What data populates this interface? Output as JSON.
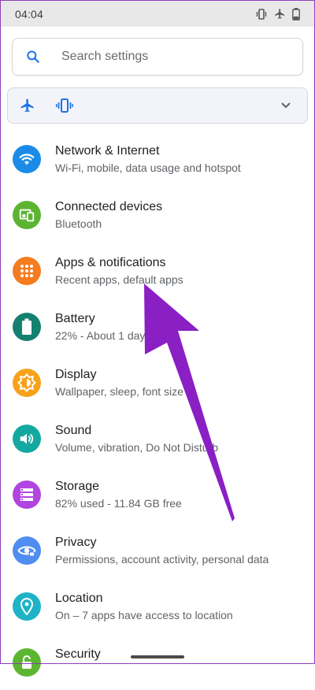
{
  "status_bar": {
    "time": "04:04",
    "icons": [
      "vibrate-icon",
      "airplane-icon",
      "battery-icon"
    ],
    "battery_label": "22"
  },
  "search": {
    "placeholder": "Search settings",
    "icon": "search-icon"
  },
  "quick_settings": {
    "icons": [
      "airplane-icon",
      "vibrate-icon",
      "chevron-down-icon"
    ]
  },
  "settings": [
    {
      "title": "Network & Internet",
      "subtitle": "Wi-Fi, mobile, data usage and hotspot",
      "icon": "wifi-icon",
      "color": "#1a8ce8"
    },
    {
      "title": "Connected devices",
      "subtitle": "Bluetooth",
      "icon": "devices-icon",
      "color": "#5cb531"
    },
    {
      "title": "Apps & notifications",
      "subtitle": "Recent apps, default apps",
      "icon": "apps-icon",
      "color": "#f57c1f"
    },
    {
      "title": "Battery",
      "subtitle": "22% - About 1 day left",
      "icon": "battery-icon",
      "color": "#14806f"
    },
    {
      "title": "Display",
      "subtitle": "Wallpaper, sleep, font size",
      "icon": "brightness-icon",
      "color": "#f7a21b"
    },
    {
      "title": "Sound",
      "subtitle": "Volume, vibration, Do Not Disturb",
      "icon": "volume-icon",
      "color": "#14a9a0"
    },
    {
      "title": "Storage",
      "subtitle": "82% used - 11.84 GB free",
      "icon": "storage-icon",
      "color": "#b145e0"
    },
    {
      "title": "Privacy",
      "subtitle": "Permissions, account activity, personal data",
      "icon": "privacy-eye-icon",
      "color": "#4f8df0"
    },
    {
      "title": "Location",
      "subtitle": "On – 7 apps have access to location",
      "icon": "location-pin-icon",
      "color": "#1fb3c7"
    },
    {
      "title": "Security",
      "subtitle": "",
      "icon": "lock-icon",
      "color": "#5cb531"
    }
  ],
  "colors": {
    "accent_blue": "#1a73e8",
    "annotation_arrow": "#8a1fc4"
  }
}
